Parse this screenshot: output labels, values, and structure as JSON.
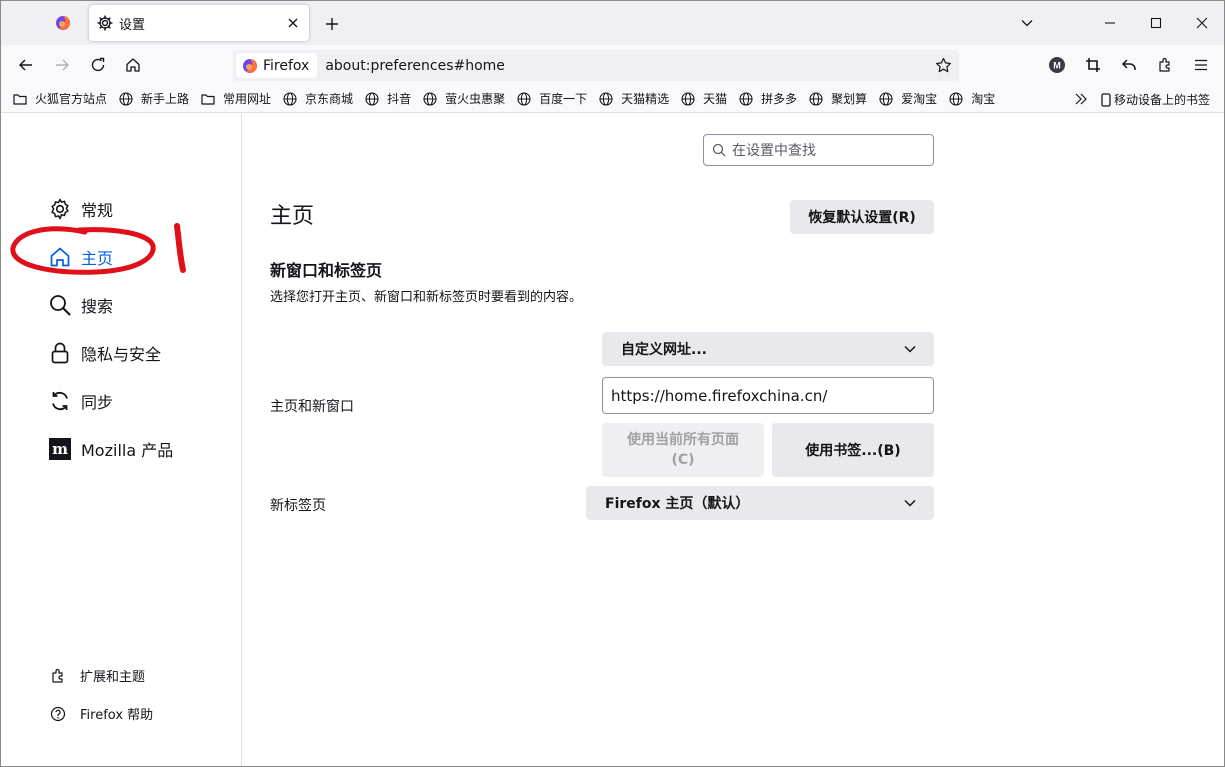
{
  "tabs": {
    "inactive_icon": "firefox-icon",
    "active_title": "设置",
    "close_icon": "close-icon",
    "new_tab_icon": "plus-icon"
  },
  "window_controls": [
    "chevron-down-icon",
    "minimize-icon",
    "maximize-icon",
    "close-icon"
  ],
  "navbar": {
    "identity_label": "Firefox",
    "url": "about:preferences#home",
    "right_icons": [
      "account-icon",
      "crop-icon",
      "undo-icon",
      "extensions-icon",
      "menu-icon"
    ]
  },
  "bookmarks": [
    {
      "label": "火狐官方站点",
      "icon": "folder-icon"
    },
    {
      "label": "新手上路",
      "icon": "globe-icon"
    },
    {
      "label": "常用网址",
      "icon": "folder-icon"
    },
    {
      "label": "京东商城",
      "icon": "globe-icon"
    },
    {
      "label": "抖音",
      "icon": "globe-icon"
    },
    {
      "label": "萤火虫惠聚",
      "icon": "globe-icon"
    },
    {
      "label": "百度一下",
      "icon": "globe-icon"
    },
    {
      "label": "天猫精选",
      "icon": "globe-icon"
    },
    {
      "label": "天猫",
      "icon": "globe-icon"
    },
    {
      "label": "拼多多",
      "icon": "globe-icon"
    },
    {
      "label": "聚划算",
      "icon": "globe-icon"
    },
    {
      "label": "爱淘宝",
      "icon": "globe-icon"
    },
    {
      "label": "淘宝",
      "icon": "globe-icon"
    }
  ],
  "mobile_bookmarks": "移动设备上的书签",
  "sidebar": {
    "categories": [
      {
        "label": "常规",
        "icon": "gear-icon"
      },
      {
        "label": "主页",
        "icon": "home-icon",
        "selected": true
      },
      {
        "label": "搜索",
        "icon": "search-icon"
      },
      {
        "label": "隐私与安全",
        "icon": "lock-icon"
      },
      {
        "label": "同步",
        "icon": "sync-icon"
      },
      {
        "label": "Mozilla 产品",
        "icon": "mozilla-icon"
      }
    ],
    "footer": [
      {
        "label": "扩展和主题",
        "icon": "puzzle-icon"
      },
      {
        "label": "Firefox 帮助",
        "icon": "help-icon"
      }
    ]
  },
  "main": {
    "search_placeholder": "在设置中查找",
    "page_title": "主页",
    "restore_button": "恢复默认设置(R)",
    "section_title": "新窗口和标签页",
    "section_desc": "选择您打开主页、新窗口和新标签页时要看到的内容。",
    "homepage_label": "主页和新窗口",
    "homepage_select": "自定义网址...",
    "homepage_url": "https://home.firefoxchina.cn/",
    "use_current_pages_line1": "使用当前所有页面",
    "use_current_pages_line2": "(C)",
    "use_bookmark_button": "使用书签...(B)",
    "newtab_label": "新标签页",
    "newtab_select": "Firefox 主页（默认）"
  },
  "colors": {
    "accent": "#0061e0",
    "annotation_red": "#e0101b"
  }
}
